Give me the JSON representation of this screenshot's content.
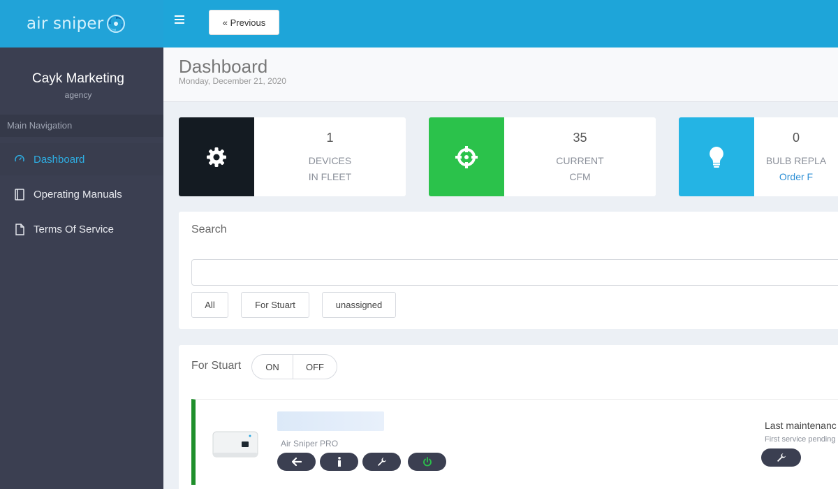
{
  "brand": {
    "logo_text": "air sniper"
  },
  "header": {
    "menu_icon": "hamburger-icon",
    "prev_label": "« Previous"
  },
  "sidebar": {
    "org_name": "Cayk Marketing",
    "org_role": "agency",
    "nav_header": "Main Navigation",
    "items": [
      {
        "label": "Dashboard",
        "icon": "dashboard-gauge-icon",
        "active": true
      },
      {
        "label": "Operating Manuals",
        "icon": "book-icon",
        "active": false
      },
      {
        "label": "Terms Of Service",
        "icon": "document-icon",
        "active": false
      }
    ]
  },
  "page": {
    "title": "Dashboard",
    "date": "Monday, December 21, 2020"
  },
  "stats": [
    {
      "value": "1",
      "line1": "DEVICES",
      "line2": "IN FLEET",
      "icon": "gear-icon",
      "color": "#141b22"
    },
    {
      "value": "35",
      "line1": "CURRENT",
      "line2": "CFM",
      "icon": "crosshair-icon",
      "color": "#2bc24b"
    },
    {
      "value": "0",
      "line1": "BULB REPLA",
      "line2": "Order F",
      "icon": "lightbulb-icon",
      "color": "#24b4e4"
    }
  ],
  "search": {
    "title": "Search",
    "placeholder": "",
    "filters": [
      "All",
      "For Stuart",
      "unassigned"
    ]
  },
  "group": {
    "title": "For Stuart",
    "on_label": "ON",
    "off_label": "OFF",
    "device": {
      "model": "Air Sniper PRO",
      "status_color": "#1f8f2b",
      "actions": [
        "back-arrow-icon",
        "info-icon",
        "wrench-icon",
        "power-icon"
      ],
      "maintenance_title": "Last maintenanc",
      "maintenance_sub": "First service pending",
      "maintenance_action": "wrench-icon"
    }
  },
  "colors": {
    "header": "#1ea5d9",
    "sidebar": "#3b3f51",
    "accent": "#2eaee3"
  }
}
